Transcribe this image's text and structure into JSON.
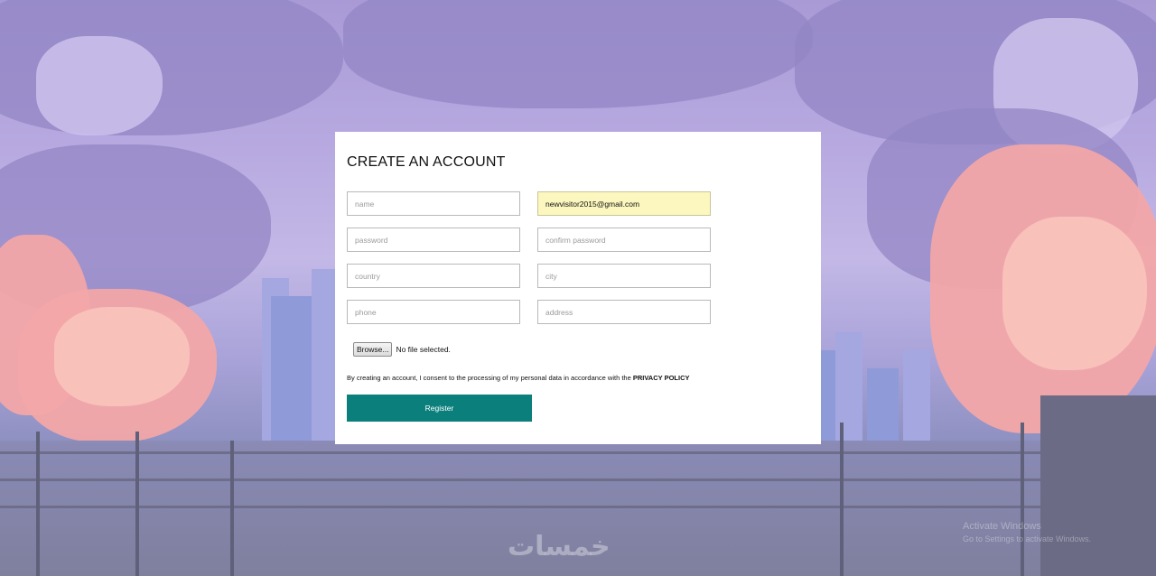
{
  "form": {
    "title": "CREATE AN ACCOUNT",
    "fields": {
      "name_placeholder": "name",
      "email_value": "newvisitor2015@gmail.com",
      "password_placeholder": "password",
      "confirm_password_placeholder": "confirm password",
      "country_placeholder": "country",
      "city_placeholder": "city",
      "phone_placeholder": "phone",
      "address_placeholder": "address"
    },
    "file": {
      "browse_label": "Browse...",
      "status": "No file selected."
    },
    "consent_text": "By creating an account, I consent to the processing of my personal data in accordance with the",
    "privacy_link": "PRIVACY POLICY",
    "register_label": "Register"
  },
  "colors": {
    "register_bg": "#0b7f7b",
    "autofill_bg": "#fcf7bf"
  },
  "watermark": {
    "logo_text": "خمسات",
    "windows_line1": "Activate Windows",
    "windows_line2": "Go to Settings to activate Windows."
  }
}
